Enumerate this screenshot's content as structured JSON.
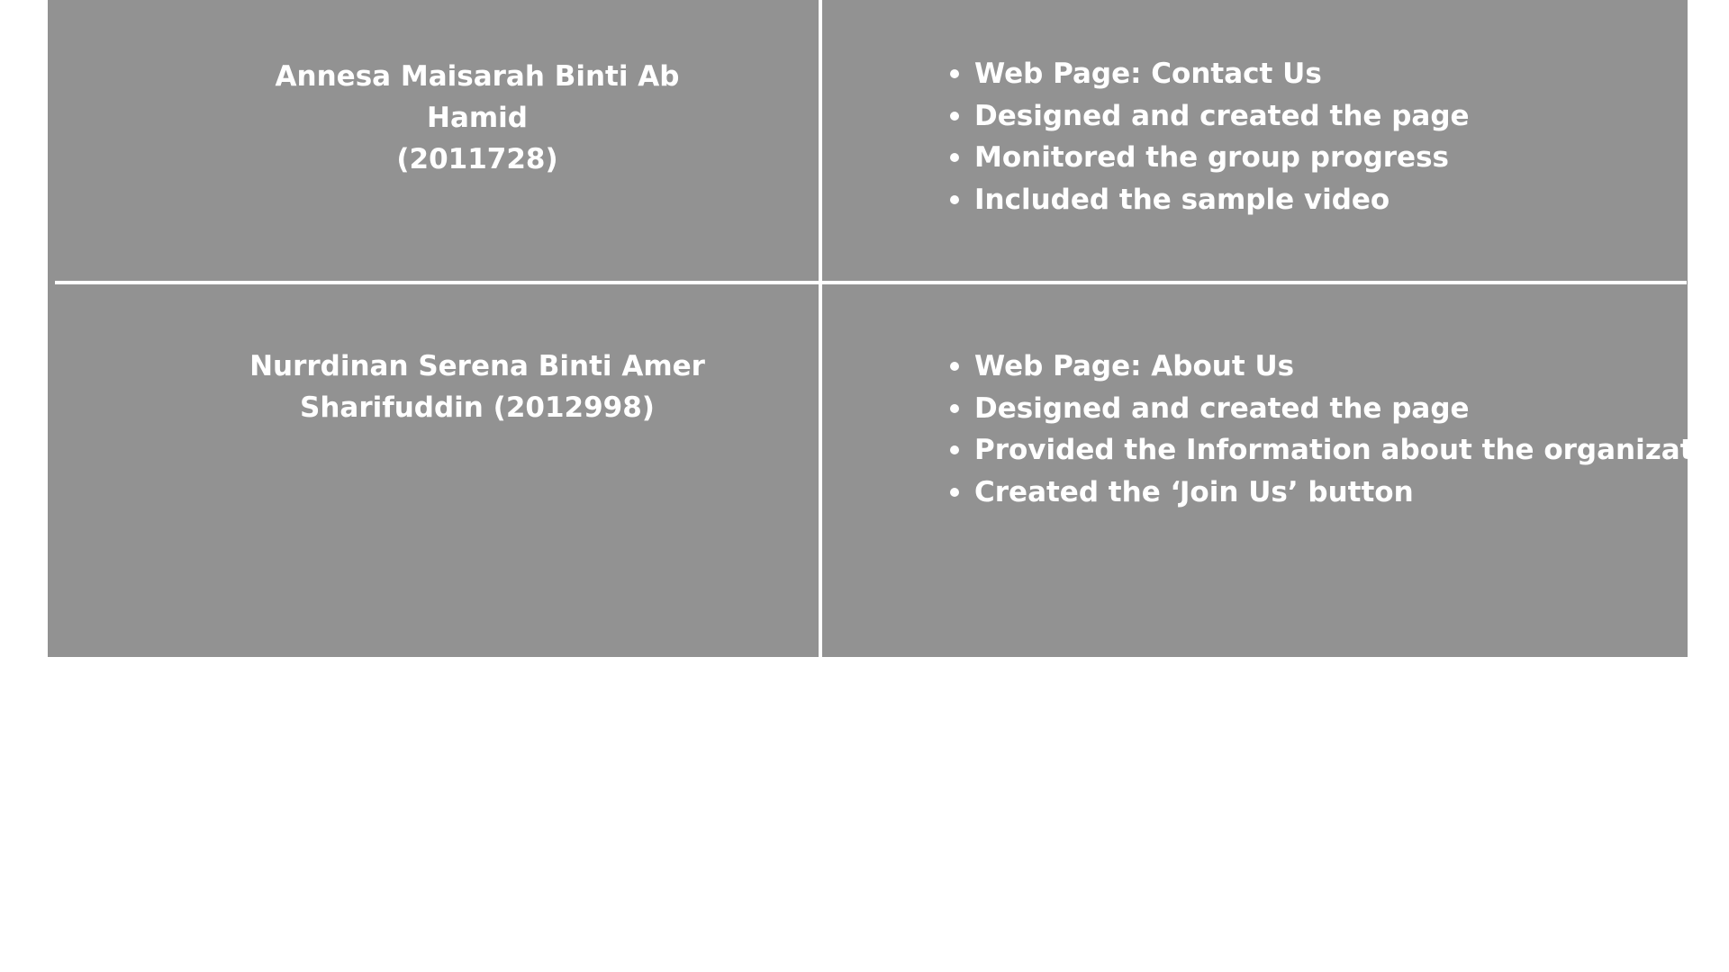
{
  "rows": [
    {
      "name_line1": "Annesa Maisarah Binti Ab Hamid",
      "name_line2": "(2011728)",
      "tasks": [
        "Web Page: Contact Us",
        "Designed and created the page",
        "Monitored the group progress",
        "Included the sample video"
      ]
    },
    {
      "name_line1": "Nurrdinan Serena Binti Amer",
      "name_line2": "Sharifuddin (2012998)",
      "tasks": [
        "Web Page: About Us",
        "Designed and created the page",
        "Provided the Information about the organization",
        "Created the ‘Join Us’ button"
      ]
    }
  ],
  "colors": {
    "cell_background": "#929292",
    "text": "#ffffff",
    "page_background": "#ffffff"
  }
}
